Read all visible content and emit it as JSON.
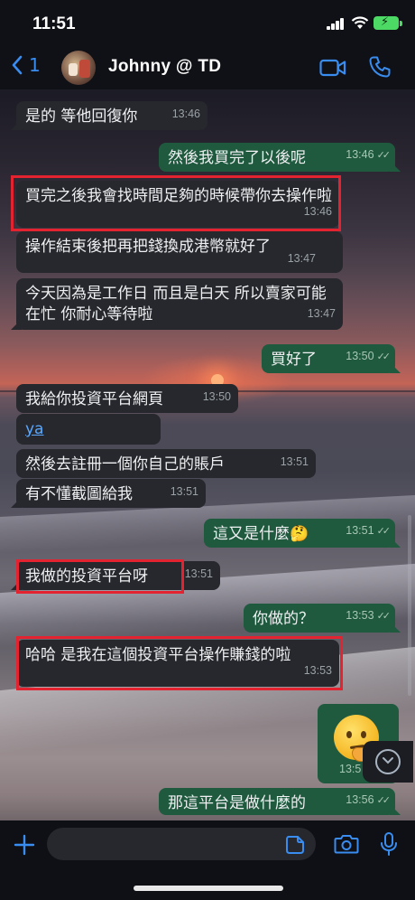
{
  "status": {
    "time": "11:51"
  },
  "header": {
    "back_count": "1",
    "contact_name": "Johnny  @ TD"
  },
  "messages": [
    {
      "dir": "in",
      "text": "是的 等他回復你",
      "time": "13:46"
    },
    {
      "dir": "out",
      "text": "然後我買完了以後呢",
      "time": "13:46"
    },
    {
      "dir": "in",
      "text": "買完之後我會找時間足夠的時候帶你去操作啦",
      "time": "13:46",
      "highlighted": true
    },
    {
      "dir": "in",
      "text": "操作結束後把再把錢換成港幣就好了",
      "time": "13:47"
    },
    {
      "dir": "in",
      "text": "今天因為是工作日 而且是白天 所以賣家可能在忙 你耐心等待啦",
      "time": "13:47"
    },
    {
      "dir": "out",
      "text": "買好了",
      "time": "13:50"
    },
    {
      "dir": "in",
      "text": "我給你投資平台網頁",
      "time": "13:50"
    },
    {
      "dir": "in",
      "text": "ya",
      "time": "",
      "is_link": true
    },
    {
      "dir": "in",
      "text": "然後去註冊一個你自己的賬戶",
      "time": "13:51"
    },
    {
      "dir": "in",
      "text": "有不懂截圖給我",
      "time": "13:51"
    },
    {
      "dir": "out",
      "text": "這又是什麼🤔",
      "time": "13:51"
    },
    {
      "dir": "in",
      "text": "我做的投資平台呀",
      "time": "13:51",
      "highlighted": true
    },
    {
      "dir": "out",
      "text": "你做的？",
      "time": "13:53"
    },
    {
      "dir": "in",
      "text": "哈哈 是我在這個投資平台操作賺錢的啦",
      "time": "13:53",
      "highlighted": true
    },
    {
      "dir": "out",
      "text": "🤔",
      "time": "13:5",
      "is_emoji": true
    },
    {
      "dir": "out",
      "text": "那這平台是做什麼的",
      "time": "13:56"
    }
  ],
  "composer": {
    "placeholder": ""
  },
  "colors": {
    "incoming": "#26282d",
    "outgoing": "#1f5a3f",
    "highlight": "#e3232f",
    "accent": "#3a8df0"
  },
  "icons": [
    "chevron-left-icon",
    "video-call-icon",
    "phone-icon",
    "plus-icon",
    "sticker-icon",
    "camera-icon",
    "microphone-icon",
    "scroll-down-icon"
  ]
}
